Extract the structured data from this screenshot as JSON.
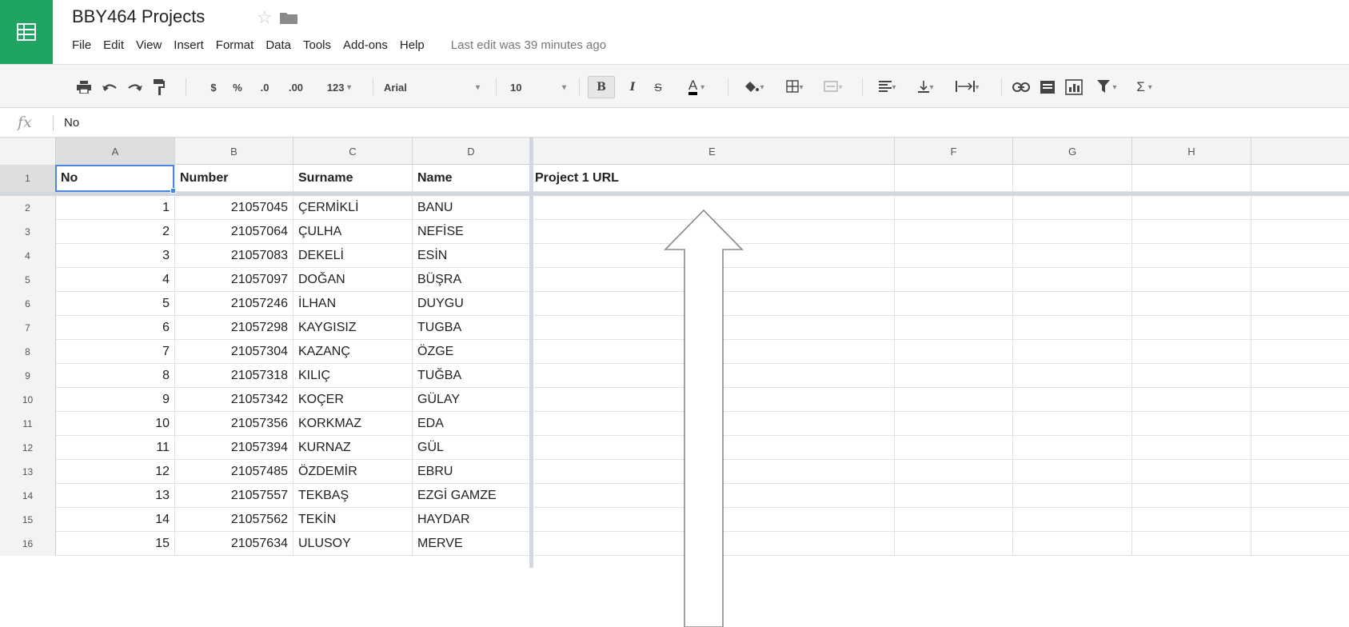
{
  "header": {
    "title": "BBY464 Projects",
    "menu": [
      "File",
      "Edit",
      "View",
      "Insert",
      "Format",
      "Data",
      "Tools",
      "Add-ons",
      "Help"
    ],
    "last_edit": "Last edit was 39 minutes ago",
    "icons": [
      "sheets-logo-icon",
      "star-icon",
      "folder-icon"
    ]
  },
  "toolbar": {
    "currency": "$",
    "percent": "%",
    "decrease_decimal": ".0",
    "increase_decimal": ".00",
    "more_formats": "123",
    "font": "Arial",
    "font_size": "10",
    "bold": "B",
    "italic": "I",
    "strike": "S",
    "text_color": "A",
    "sigma": "Σ"
  },
  "formula_bar": {
    "fx": "fx",
    "value": "No"
  },
  "grid": {
    "columns": [
      "A",
      "B",
      "C",
      "D",
      "E",
      "F",
      "G",
      "H"
    ],
    "header_row": {
      "row_number": "1",
      "cells": [
        "No",
        "Number",
        "Surname",
        "Name",
        "Project 1 URL"
      ]
    },
    "rows": [
      {
        "row_number": "2",
        "no": "1",
        "number": "21057045",
        "surname": "ÇERMİKLİ",
        "name": "BANU"
      },
      {
        "row_number": "3",
        "no": "2",
        "number": "21057064",
        "surname": "ÇULHA",
        "name": "NEFİSE"
      },
      {
        "row_number": "4",
        "no": "3",
        "number": "21057083",
        "surname": "DEKELİ",
        "name": "ESİN"
      },
      {
        "row_number": "5",
        "no": "4",
        "number": "21057097",
        "surname": "DOĞAN",
        "name": "BÜŞRA"
      },
      {
        "row_number": "6",
        "no": "5",
        "number": "21057246",
        "surname": "İLHAN",
        "name": "DUYGU"
      },
      {
        "row_number": "7",
        "no": "6",
        "number": "21057298",
        "surname": "KAYGISIZ",
        "name": "TUGBA"
      },
      {
        "row_number": "8",
        "no": "7",
        "number": "21057304",
        "surname": "KAZANÇ",
        "name": "ÖZGE"
      },
      {
        "row_number": "9",
        "no": "8",
        "number": "21057318",
        "surname": "KILIÇ",
        "name": "TUĞBA"
      },
      {
        "row_number": "10",
        "no": "9",
        "number": "21057342",
        "surname": "KOÇER",
        "name": "GÜLAY"
      },
      {
        "row_number": "11",
        "no": "10",
        "number": "21057356",
        "surname": "KORKMAZ",
        "name": "EDA"
      },
      {
        "row_number": "12",
        "no": "11",
        "number": "21057394",
        "surname": "KURNAZ",
        "name": "GÜL"
      },
      {
        "row_number": "13",
        "no": "12",
        "number": "21057485",
        "surname": "ÖZDEMİR",
        "name": "EBRU"
      },
      {
        "row_number": "14",
        "no": "13",
        "number": "21057557",
        "surname": "TEKBAŞ",
        "name": "EZGİ GAMZE"
      },
      {
        "row_number": "15",
        "no": "14",
        "number": "21057562",
        "surname": "TEKİN",
        "name": "HAYDAR"
      },
      {
        "row_number": "16",
        "no": "15",
        "number": "21057634",
        "surname": "ULUSOY",
        "name": "MERVE"
      }
    ]
  },
  "colors": {
    "logo_green": "#1fa463",
    "selection_blue": "#4a86e8",
    "freeze_line": "#d3d7df"
  }
}
